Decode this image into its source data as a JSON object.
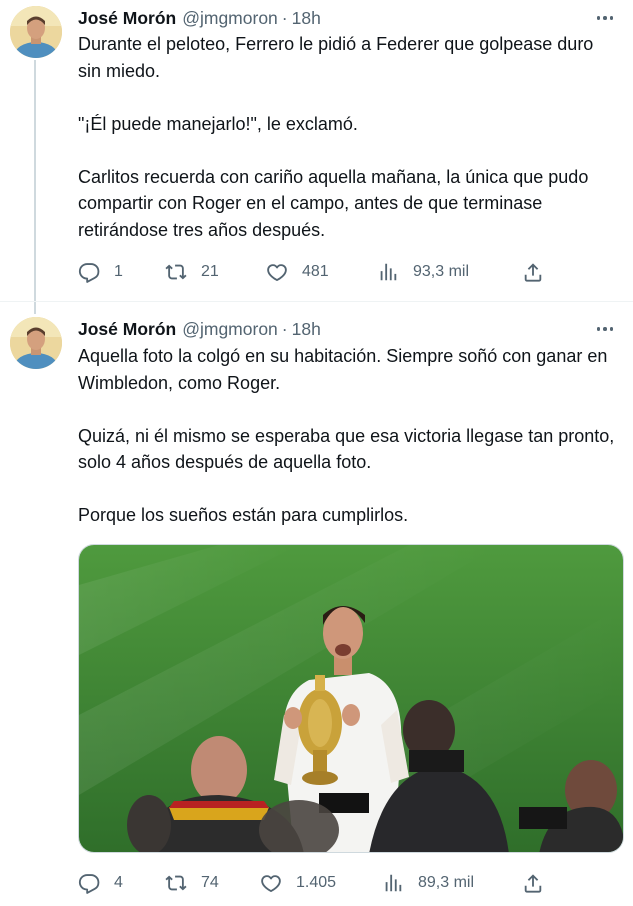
{
  "tweets": [
    {
      "author_name": "José Morón",
      "handle": "@jmgmoron",
      "separator": "·",
      "time": "18h",
      "paragraphs": [
        "Durante el peloteo, Ferrero le pidió a Federer que golpease duro sin miedo.",
        "\"¡Él puede manejarlo!\", le exclamó.",
        "Carlitos recuerda con cariño aquella mañana, la única que pudo compartir con Roger en el campo, antes de que terminase retirándose tres años después."
      ],
      "stats": {
        "replies": "1",
        "retweets": "21",
        "likes": "481",
        "views": "93,3 mil"
      }
    },
    {
      "author_name": "José Morón",
      "handle": "@jmgmoron",
      "separator": "·",
      "time": "18h",
      "paragraphs": [
        "Aquella foto la colgó en su habitación. Siempre soñó con ganar en Wimbledon, como Roger.",
        "Quizá, ni él mismo se esperaba que esa victoria llegase tan pronto, solo 4 años después de aquella foto.",
        "Porque los sueños están para cumplirlos."
      ],
      "stats": {
        "replies": "4",
        "retweets": "74",
        "likes": "1.405",
        "views": "89,3 mil"
      }
    }
  ],
  "icons": {
    "reply": "reply-icon",
    "retweet": "retweet-icon",
    "like": "heart-icon",
    "views": "views-icon",
    "share": "share-icon",
    "more": "more-icon"
  },
  "colors": {
    "text": "#0f1419",
    "secondary": "#536471",
    "thread_line": "#cfd9de",
    "grass": "#3f8a34"
  }
}
